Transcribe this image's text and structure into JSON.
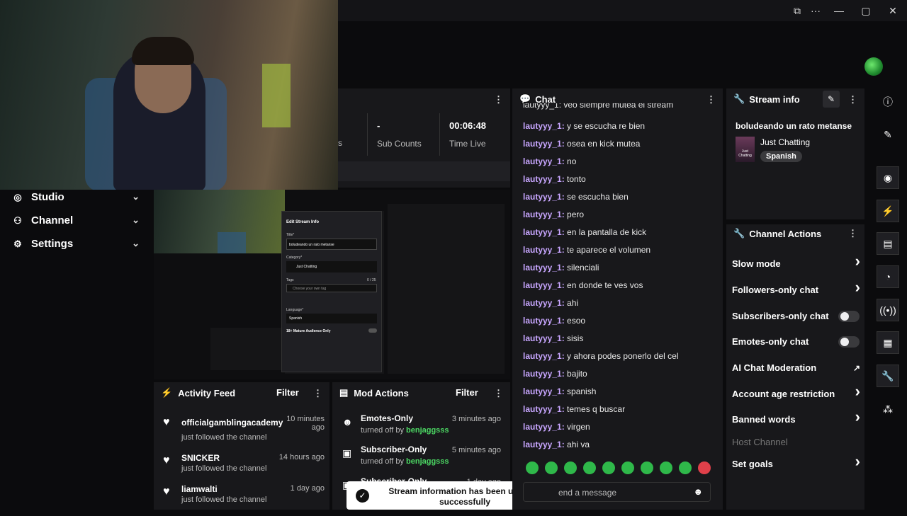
{
  "window": {
    "icons": [
      "screen-icon",
      "more-icon",
      "minimize-icon",
      "restore-icon",
      "close-icon"
    ],
    "glyphs": [
      "⧉",
      "···",
      "—",
      "▢",
      "✕"
    ]
  },
  "sidebar": {
    "items": [
      {
        "label": "Studio",
        "icon": "studio-icon",
        "glyph": "◎"
      },
      {
        "label": "Channel",
        "icon": "channel-icon",
        "glyph": "⚇"
      },
      {
        "label": "Settings",
        "icon": "gear-icon",
        "glyph": "⚙"
      }
    ]
  },
  "stats": {
    "items": [
      {
        "value": "",
        "label": "s"
      },
      {
        "value": "-",
        "label": "Sub Counts"
      },
      {
        "value": "00:06:48",
        "label": "Time Live"
      }
    ]
  },
  "chat": {
    "title": "Chat",
    "partial_line": "lautyyy_1: veo siempre mutea el stream",
    "lines": [
      {
        "user": "lautyyy_1:",
        "text": " y se escucha re bien"
      },
      {
        "user": "lautyyy_1:",
        "text": " osea en kick mutea"
      },
      {
        "user": "lautyyy_1:",
        "text": " no"
      },
      {
        "user": "lautyyy_1:",
        "text": " tonto"
      },
      {
        "user": "lautyyy_1:",
        "text": " se escucha bien"
      },
      {
        "user": "lautyyy_1:",
        "text": " pero"
      },
      {
        "user": "lautyyy_1:",
        "text": " en la pantalla de kick"
      },
      {
        "user": "lautyyy_1:",
        "text": " te aparece el volumen"
      },
      {
        "user": "lautyyy_1:",
        "text": " silenciali"
      },
      {
        "user": "lautyyy_1:",
        "text": " en donde te ves vos"
      },
      {
        "user": "lautyyy_1:",
        "text": " ahi"
      },
      {
        "user": "lautyyy_1:",
        "text": " esoo"
      },
      {
        "user": "lautyyy_1:",
        "text": " sisis"
      },
      {
        "user": "lautyyy_1:",
        "text": " y ahora podes ponerlo del cel"
      },
      {
        "user": "lautyyy_1:",
        "text": " bajito"
      },
      {
        "user": "lautyyy_1:",
        "text": " spanish"
      },
      {
        "user": "lautyyy_1:",
        "text": " temes q buscar"
      },
      {
        "user": "lautyyy_1:",
        "text": " virgen"
      },
      {
        "user": "lautyyy_1:",
        "text": " ahi va"
      }
    ],
    "input_placeholder": "end a message"
  },
  "stream_info": {
    "title": "Stream info",
    "stream_title": "boludeando un rato metanse",
    "category": "Just Chatting",
    "category_thumb": "Just Chatting",
    "language": "Spanish"
  },
  "channel_actions": {
    "title": "Channel Actions",
    "items": [
      {
        "label": "Slow mode",
        "kind": "arrow"
      },
      {
        "label": "Followers-only chat",
        "kind": "arrow"
      },
      {
        "label": "Subscribers-only chat",
        "kind": "toggle"
      },
      {
        "label": "Emotes-only chat",
        "kind": "toggle"
      },
      {
        "label": "AI Chat Moderation",
        "kind": "external"
      },
      {
        "label": "Account age restriction",
        "kind": "arrow"
      },
      {
        "label": "Banned words",
        "kind": "arrow"
      },
      {
        "label": "Host Channel",
        "kind": "disabled"
      },
      {
        "label": "Set goals",
        "kind": "arrow"
      }
    ]
  },
  "activity_feed": {
    "title": "Activity Feed",
    "filter": "Filter",
    "items": [
      {
        "name": "officialgamblingacademy",
        "sub": "just followed the channel",
        "time": "10 minutes ago"
      },
      {
        "name": "SNICKER",
        "sub": "just followed the channel",
        "time": "14 hours ago"
      },
      {
        "name": "liamwalti",
        "sub": "just followed the channel",
        "time": "1 day ago"
      }
    ]
  },
  "mod_actions": {
    "title": "Mod Actions",
    "filter": "Filter",
    "items": [
      {
        "name": "Emotes-Only",
        "sub": "turned off by ",
        "by": "benjaggsss",
        "time": "3 minutes ago",
        "icon": "emote-icon",
        "glyph": "☻"
      },
      {
        "name": "Subscriber-Only",
        "sub": "turned off by ",
        "by": "benjaggsss",
        "time": "5 minutes ago",
        "icon": "gift-icon",
        "glyph": "🎁"
      },
      {
        "name": "Subscriber-Only",
        "sub": "",
        "by": "",
        "time": "1 day ago",
        "icon": "gift-icon",
        "glyph": "🎁"
      }
    ]
  },
  "toast": {
    "text": "Stream information has been updated successfully"
  },
  "preview": {
    "modal_title": "Edit Stream Info",
    "title_label": "Title*",
    "title_value": "boludeando un rato metanse",
    "category_label": "Category*",
    "category_value": "Just Chatting",
    "tags_label": "Tags",
    "tags_count": "0 / 25",
    "tags_placeholder": "Choose your own tag",
    "language_label": "Language*",
    "language_value": "Spanish",
    "mature_label": "18+ Mature Audience Only"
  },
  "colors": {
    "accent": "#53fc18",
    "username": "#c8a6ff",
    "panel": "#18181b"
  }
}
